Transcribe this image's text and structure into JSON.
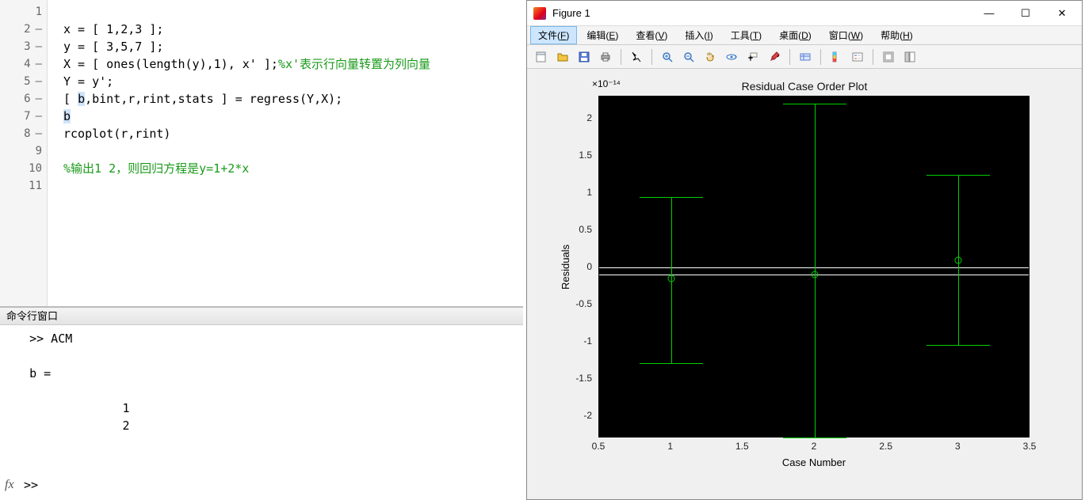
{
  "editor": {
    "lines": [
      {
        "num": "1",
        "dash": "",
        "text": ""
      },
      {
        "num": "2",
        "dash": "–",
        "text": "x = [ 1,2,3 ];"
      },
      {
        "num": "3",
        "dash": "–",
        "text": "y = [ 3,5,7 ];"
      },
      {
        "num": "4",
        "dash": "–",
        "text": "X = [ ones(length(y),1), x' ];",
        "comment": "%x'表示行向量转置为列向量"
      },
      {
        "num": "5",
        "dash": "–",
        "text": "Y = y';"
      },
      {
        "num": "6",
        "dash": "–",
        "pre": "[ ",
        "hl": "b",
        "post": ",bint,r,rint,stats ] = regress(Y,X);"
      },
      {
        "num": "7",
        "dash": "–",
        "hl": "b"
      },
      {
        "num": "8",
        "dash": "–",
        "text": "rcoplot(r,rint)"
      },
      {
        "num": "9",
        "dash": "",
        "text": ""
      },
      {
        "num": "10",
        "dash": "",
        "comment": "%输出1 2，则回归方程是y=1+2*x"
      },
      {
        "num": "11",
        "dash": "",
        "text": ""
      }
    ]
  },
  "commandWindow": {
    "title": "命令行窗口",
    "lines": [
      "   >> ACM",
      "",
      "   b =",
      "",
      "                1",
      "                2",
      ""
    ],
    "fx": "fx",
    "prompt": ">> "
  },
  "figure": {
    "title": "Figure 1",
    "menus": {
      "file": "文件(F)",
      "edit": "编辑(E)",
      "view": "查看(V)",
      "insert": "插入(I)",
      "tools": "工具(T)",
      "desktop": "桌面(D)",
      "window": "窗口(W)",
      "help": "帮助(H)"
    },
    "win": {
      "min": "—",
      "max": "☐",
      "close": "✕"
    }
  },
  "chart_data": {
    "type": "errorbar",
    "title": "Residual Case Order Plot",
    "xlabel": "Case Number",
    "ylabel": "Residuals",
    "y_exponent": "×10⁻¹⁴",
    "xlim": [
      0.5,
      3.5
    ],
    "ylim": [
      -2.3,
      2.3
    ],
    "xticks": [
      "0.5",
      "1",
      "1.5",
      "2",
      "2.5",
      "3",
      "3.5"
    ],
    "yticks": [
      "-2",
      "-1.5",
      "-1",
      "-0.5",
      "0",
      "0.5",
      "1",
      "1.5",
      "2"
    ],
    "points": [
      {
        "x": 1,
        "y": -0.15,
        "lo": -1.3,
        "hi": 0.95
      },
      {
        "x": 2,
        "y": -0.1,
        "lo": -2.3,
        "hi": 2.2
      },
      {
        "x": 3,
        "y": 0.1,
        "lo": -1.05,
        "hi": 1.25
      }
    ],
    "fit_line_y": -0.1
  }
}
